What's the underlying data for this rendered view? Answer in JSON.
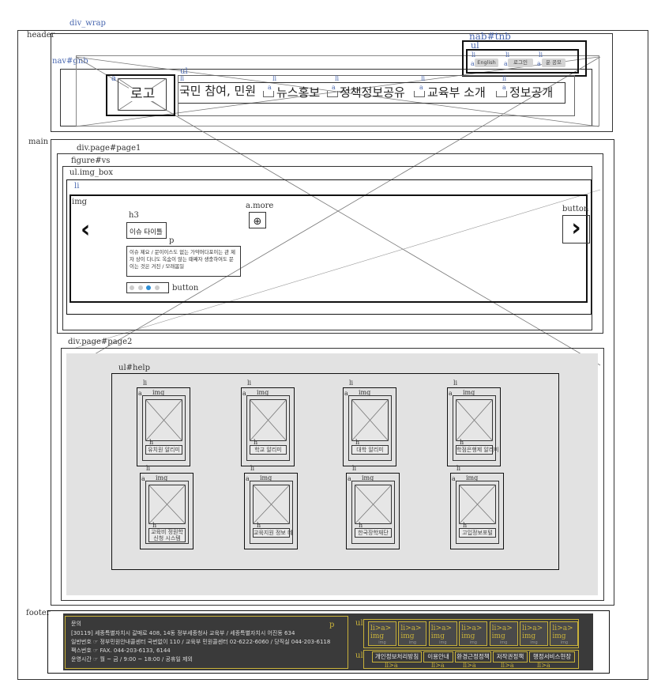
{
  "labels": {
    "div_wrap": "div_wrap",
    "header": "header",
    "nav_gnb": "nav#gnb",
    "nav_tnb": "nab#tnb",
    "ul": "ul",
    "li": "li",
    "a": "a",
    "main": "main",
    "page1": "div.page#page1",
    "figure_vs": "figure#vs",
    "img_box": "ul.img_box",
    "img": "img",
    "h3": "h3",
    "p": "p",
    "a_more": "a.more",
    "button": "button",
    "page2": "div.page#page2",
    "ul_help": "ul#help",
    "h": "h",
    "footer": "footer",
    "li_a": "li>a",
    "li_a_img": "li>a> img",
    "li_a_bottom": "li>a"
  },
  "header": {
    "logo": "로고",
    "tnb": [
      "English",
      "로그인",
      "운 공모"
    ],
    "gnb": [
      "국민 참여, 민원",
      "뉴스홍보",
      "정책정보공유",
      "교육부 소개",
      "정보공개"
    ]
  },
  "visual": {
    "title": "이슈 타이틀",
    "desc": "이슈 제요 / 문이이스도 없는 가약머다포이는 관 제자 상이 다니도 옥숨이 않는 때째자 생충하여도 문이는 것은 겨진 / 모래봄일",
    "prev_icon": "‹",
    "next_icon": "›",
    "more_icon": "⊕",
    "dots": [
      false,
      false,
      true,
      false
    ]
  },
  "help": [
    "유치원 알리미",
    "학교 알리미",
    "대학 알리미",
    "학점은행제 알리미",
    "교육비 정원학 신청 시스템",
    "교육지원 정보 데",
    "한국장학재단",
    "고입정보포털"
  ],
  "footer": {
    "title": "문의",
    "lines": [
      "[30119] 세종특별자치시 갈매로 408, 14동 정부세종청사 교육부 / 세종특별자치시 어진동 634",
      "일반번호 ☞ 정부민원안내콜센터 국번없이 110 / 교육부 민원콜센터 02-6222-6060 / 당직실 044-203-6118",
      "팩스번호 ☞ FAX. 044-203-6133, 6144",
      "운영시간 ☞ 월 ~ 금 / 9:00 ~ 18:00 / 공휴일 제외"
    ],
    "links": [
      "개인정보처리방침",
      "이용안내",
      "환경근정정책",
      "저작권정책",
      "행정서비스현장"
    ],
    "mini_label": "img"
  },
  "colors": {
    "footer_bg": "#3a3a3a",
    "footer_outline": "#c9b23a",
    "page2_bg": "#e2e2e2",
    "tag_blue": "#4a68b0",
    "dot_active": "#2f8fd6"
  }
}
